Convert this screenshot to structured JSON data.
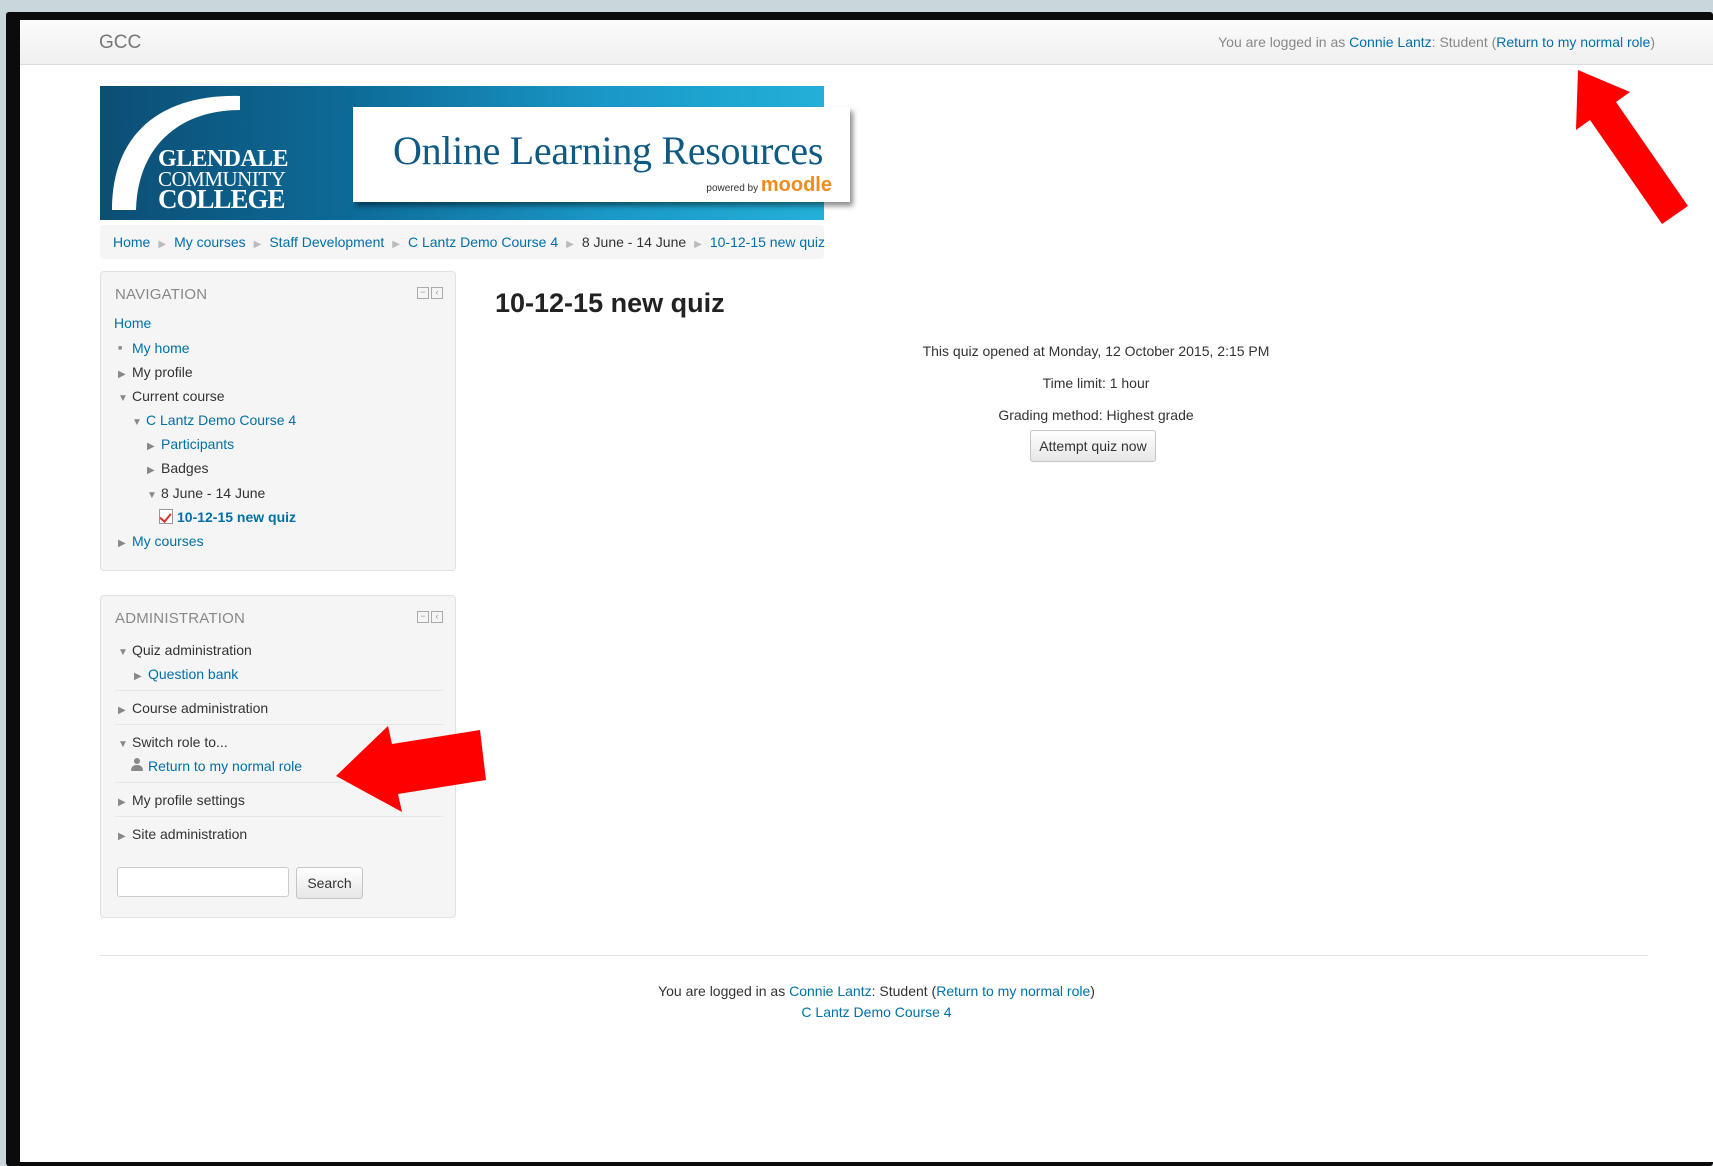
{
  "topbar": {
    "brand": "GCC",
    "login_prefix": "You are logged in as ",
    "user_name": "Connie Lantz",
    "role_text": ": Student (",
    "return_link": "Return to my normal role",
    "close_paren": ")"
  },
  "banner": {
    "college_line1": "GLENDALE",
    "college_line2": "COMMUNITY",
    "college_line3": "COLLEGE",
    "title": "Online Learning Resources",
    "powered_by": "powered by",
    "moodle": "moodle"
  },
  "breadcrumb": [
    "Home",
    "My courses",
    "Staff Development",
    "C Lantz Demo Course 4",
    "8 June - 14 June",
    "10-12-15 new quiz"
  ],
  "navigation": {
    "title": "NAVIGATION",
    "home": "Home",
    "my_home": "My home",
    "my_profile": "My profile",
    "current_course": "Current course",
    "course": "C Lantz Demo Course 4",
    "participants": "Participants",
    "badges": "Badges",
    "week": "8 June - 14 June",
    "quiz": "10-12-15 new quiz",
    "my_courses": "My courses"
  },
  "administration": {
    "title": "ADMINISTRATION",
    "quiz_admin": "Quiz administration",
    "question_bank": "Question bank",
    "course_admin": "Course administration",
    "switch_role": "Switch role to...",
    "return_role": "Return to my normal role",
    "profile_settings": "My profile settings",
    "site_admin": "Site administration",
    "search_label": "Search",
    "search_value": ""
  },
  "main": {
    "title": "10-12-15 new quiz",
    "opened": "This quiz opened at Monday, 12 October 2015, 2:15 PM",
    "time_limit": "Time limit: 1 hour",
    "grading": "Grading method: Highest grade",
    "attempt_button": "Attempt quiz now"
  },
  "footer": {
    "login_prefix": "You are logged in as ",
    "user_name": "Connie Lantz",
    "role_text": ": Student (",
    "return_link": "Return to my normal role",
    "close_paren": ")",
    "course_link": "C Lantz Demo Course 4"
  },
  "colors": {
    "link": "#0070a8",
    "annotation_arrow": "#ff0000",
    "moodle_orange": "#f08b1d"
  }
}
